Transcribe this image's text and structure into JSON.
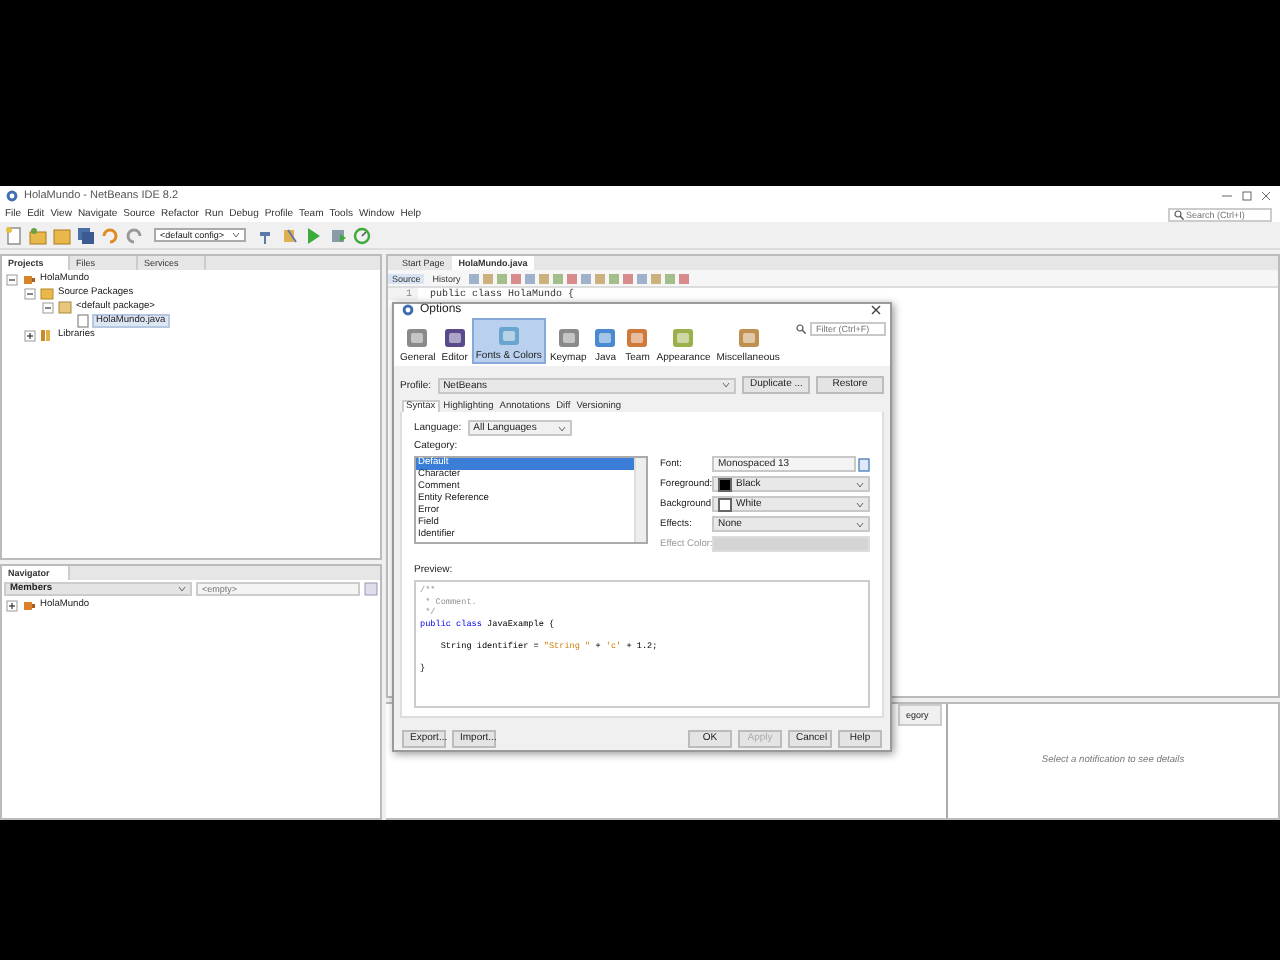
{
  "window": {
    "title": "HolaMundo - NetBeans IDE 8.2"
  },
  "menu": [
    "File",
    "Edit",
    "View",
    "Navigate",
    "Source",
    "Refactor",
    "Run",
    "Debug",
    "Profile",
    "Team",
    "Tools",
    "Window",
    "Help"
  ],
  "search": {
    "placeholder": "Search (Ctrl+I)"
  },
  "toolbar": {
    "config": "<default config>"
  },
  "projects_panel": {
    "tabs": [
      {
        "label": "Projects",
        "selected": true
      },
      {
        "label": "Files",
        "selected": false
      },
      {
        "label": "Services",
        "selected": false
      }
    ],
    "tree": [
      {
        "label": "HolaMundo",
        "kind": "project",
        "selected": false,
        "expanded": true,
        "children": [
          {
            "label": "Source Packages",
            "kind": "folder",
            "selected": false,
            "expanded": true,
            "children": [
              {
                "label": "<default package>",
                "kind": "package",
                "selected": false,
                "expanded": true,
                "children": [
                  {
                    "label": "HolaMundo.java",
                    "kind": "file",
                    "selected": true
                  }
                ]
              }
            ]
          },
          {
            "label": "Libraries",
            "kind": "library",
            "selected": false,
            "expanded": false
          }
        ]
      }
    ]
  },
  "navigator": {
    "title": "Navigator",
    "filter": "Members",
    "search": {
      "placeholder": "<empty>"
    },
    "tree": [
      {
        "label": "HolaMundo",
        "kind": "project",
        "selected": false,
        "expanded": false
      }
    ]
  },
  "editor": {
    "tabs": [
      {
        "label": "Start Page",
        "selected": false
      },
      {
        "label": "HolaMundo.java",
        "selected": true
      }
    ],
    "views": [
      {
        "label": "Source",
        "selected": true
      },
      {
        "label": "History",
        "selected": false
      }
    ],
    "lines": [
      {
        "number": "1",
        "code": "public class HolaMundo {"
      }
    ]
  },
  "notifications": {
    "column_header": "egory",
    "message": "Select a notification to see details"
  },
  "options_dialog": {
    "title": "Options",
    "categories": [
      {
        "label": "General",
        "selected": false
      },
      {
        "label": "Editor",
        "selected": false
      },
      {
        "label": "Fonts & Colors",
        "selected": true
      },
      {
        "label": "Keymap",
        "selected": false
      },
      {
        "label": "Java",
        "selected": false
      },
      {
        "label": "Team",
        "selected": false
      },
      {
        "label": "Appearance",
        "selected": false
      },
      {
        "label": "Miscellaneous",
        "selected": false
      }
    ],
    "filter": {
      "placeholder": "Filter (Ctrl+F)"
    },
    "profile": {
      "label": "Profile:",
      "value": "NetBeans"
    },
    "profile_buttons": [
      "Duplicate ...",
      "Restore"
    ],
    "tabs": [
      {
        "label": "Syntax",
        "selected": true
      },
      {
        "label": "Highlighting",
        "selected": false
      },
      {
        "label": "Annotations",
        "selected": false
      },
      {
        "label": "Diff",
        "selected": false
      },
      {
        "label": "Versioning",
        "selected": false
      }
    ],
    "language": {
      "label": "Language:",
      "value": "All Languages"
    },
    "category_label": "Category:",
    "category_list": [
      {
        "label": "Default",
        "selected": true
      },
      {
        "label": "Character",
        "selected": false
      },
      {
        "label": "Comment",
        "selected": false
      },
      {
        "label": "Entity Reference",
        "selected": false
      },
      {
        "label": "Error",
        "selected": false
      },
      {
        "label": "Field",
        "selected": false
      },
      {
        "label": "Identifier",
        "selected": false
      }
    ],
    "properties": [
      {
        "label": "Font:",
        "kind": "font",
        "value": "Monospaced 13",
        "disabled": false
      },
      {
        "label": "Foreground:",
        "kind": "color",
        "value": "Black",
        "color": "#000000",
        "disabled": false
      },
      {
        "label": "Background:",
        "kind": "color",
        "value": "White",
        "color": "#ffffff",
        "disabled": false
      },
      {
        "label": "Effects:",
        "kind": "select",
        "value": "None",
        "disabled": false
      },
      {
        "label": "Effect Color:",
        "kind": "select",
        "disabled": true
      }
    ],
    "preview_label": "Preview:",
    "preview": [
      [
        {
          "kind": "comment",
          "text": "/**"
        }
      ],
      [
        {
          "kind": "comment",
          "text": " * Comment."
        }
      ],
      [
        {
          "kind": "comment",
          "text": " */"
        }
      ],
      [
        {
          "kind": "keyword",
          "text": "public class"
        },
        {
          "kind": "plain",
          "text": " JavaExample {"
        }
      ],
      [
        {
          "kind": "plain",
          "text": "    String identifier = "
        },
        {
          "kind": "string",
          "text": "\"String \""
        },
        {
          "kind": "plain",
          "text": " + "
        },
        {
          "kind": "char",
          "text": "'c'"
        },
        {
          "kind": "plain",
          "text": " + "
        },
        {
          "kind": "number",
          "text": "1.2"
        },
        {
          "kind": "plain",
          "text": ";"
        }
      ],
      [
        {
          "kind": "plain",
          "text": "}"
        }
      ]
    ],
    "buttons": [
      {
        "label": "Export...",
        "disabled": false
      },
      {
        "label": "Import...",
        "disabled": false
      },
      {
        "label": "OK",
        "disabled": false
      },
      {
        "label": "Apply",
        "disabled": true
      },
      {
        "label": "Cancel",
        "disabled": false
      },
      {
        "label": "Help",
        "disabled": false
      }
    ]
  }
}
